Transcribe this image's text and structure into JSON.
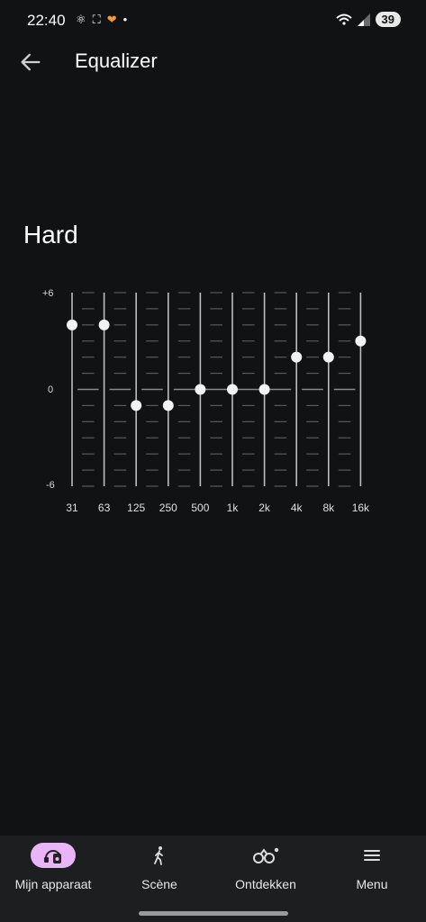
{
  "status": {
    "time": "22:40",
    "battery": "39",
    "left_icons": [
      "react-icon",
      "screenshot-icon",
      "health-icon",
      "dot-icon"
    ],
    "right_icons": [
      "wifi-icon",
      "signal-icon"
    ]
  },
  "header": {
    "title": "Equalizer",
    "back_icon": "arrow-left-icon"
  },
  "preset": {
    "name": "Hard"
  },
  "chart_data": {
    "type": "line",
    "title": "",
    "categories": [
      "31",
      "63",
      "125",
      "250",
      "500",
      "1k",
      "2k",
      "4k",
      "8k",
      "16k"
    ],
    "values": [
      4,
      4,
      -1,
      -1,
      0,
      0,
      0,
      2,
      2,
      3
    ],
    "ylim": [
      -6,
      6
    ],
    "yticks": [
      "+6",
      "0",
      "-6"
    ],
    "grid": true
  },
  "nav": {
    "items": [
      {
        "label": "Mijn apparaat",
        "icon": "device-icon",
        "active": true
      },
      {
        "label": "Scène",
        "icon": "walking-icon",
        "active": false
      },
      {
        "label": "Ontdekken",
        "icon": "binoculars-icon",
        "active": false
      },
      {
        "label": "Menu",
        "icon": "menu-icon",
        "active": false
      }
    ]
  }
}
